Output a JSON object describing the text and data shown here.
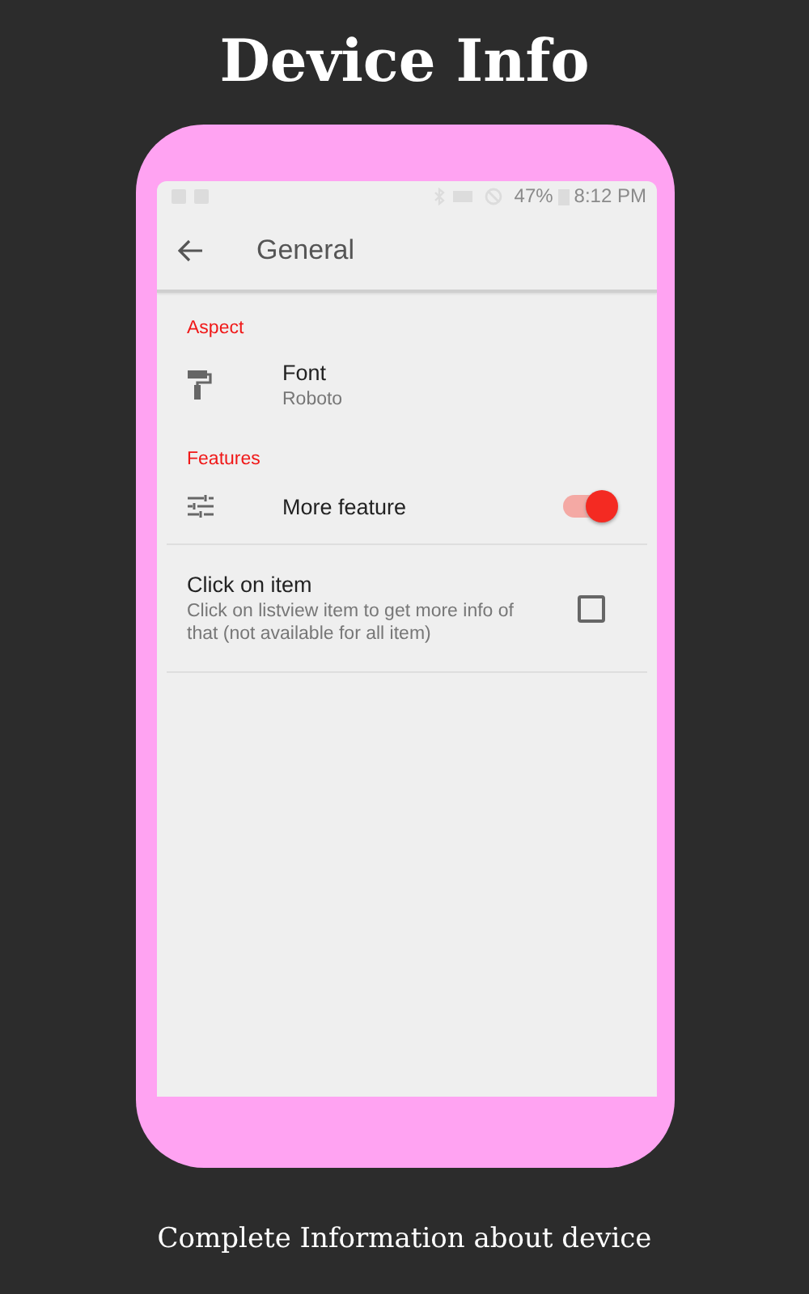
{
  "headline": "Device Info",
  "status_bar": {
    "battery": "47%",
    "time": "8:12 PM"
  },
  "toolbar": {
    "title": "General"
  },
  "sections": [
    {
      "title": "Aspect",
      "items": [
        {
          "kind": "text",
          "title": "Font",
          "subtitle": "Roboto"
        }
      ]
    },
    {
      "title": "Features",
      "items": [
        {
          "kind": "switch",
          "title": "More feature",
          "on": true
        },
        {
          "kind": "checkbox",
          "title": "Click on item",
          "subtitle": "Click on listview item to get more info of that (not available for all item)",
          "checked": false
        }
      ]
    }
  ],
  "caption": "Complete Information about device"
}
